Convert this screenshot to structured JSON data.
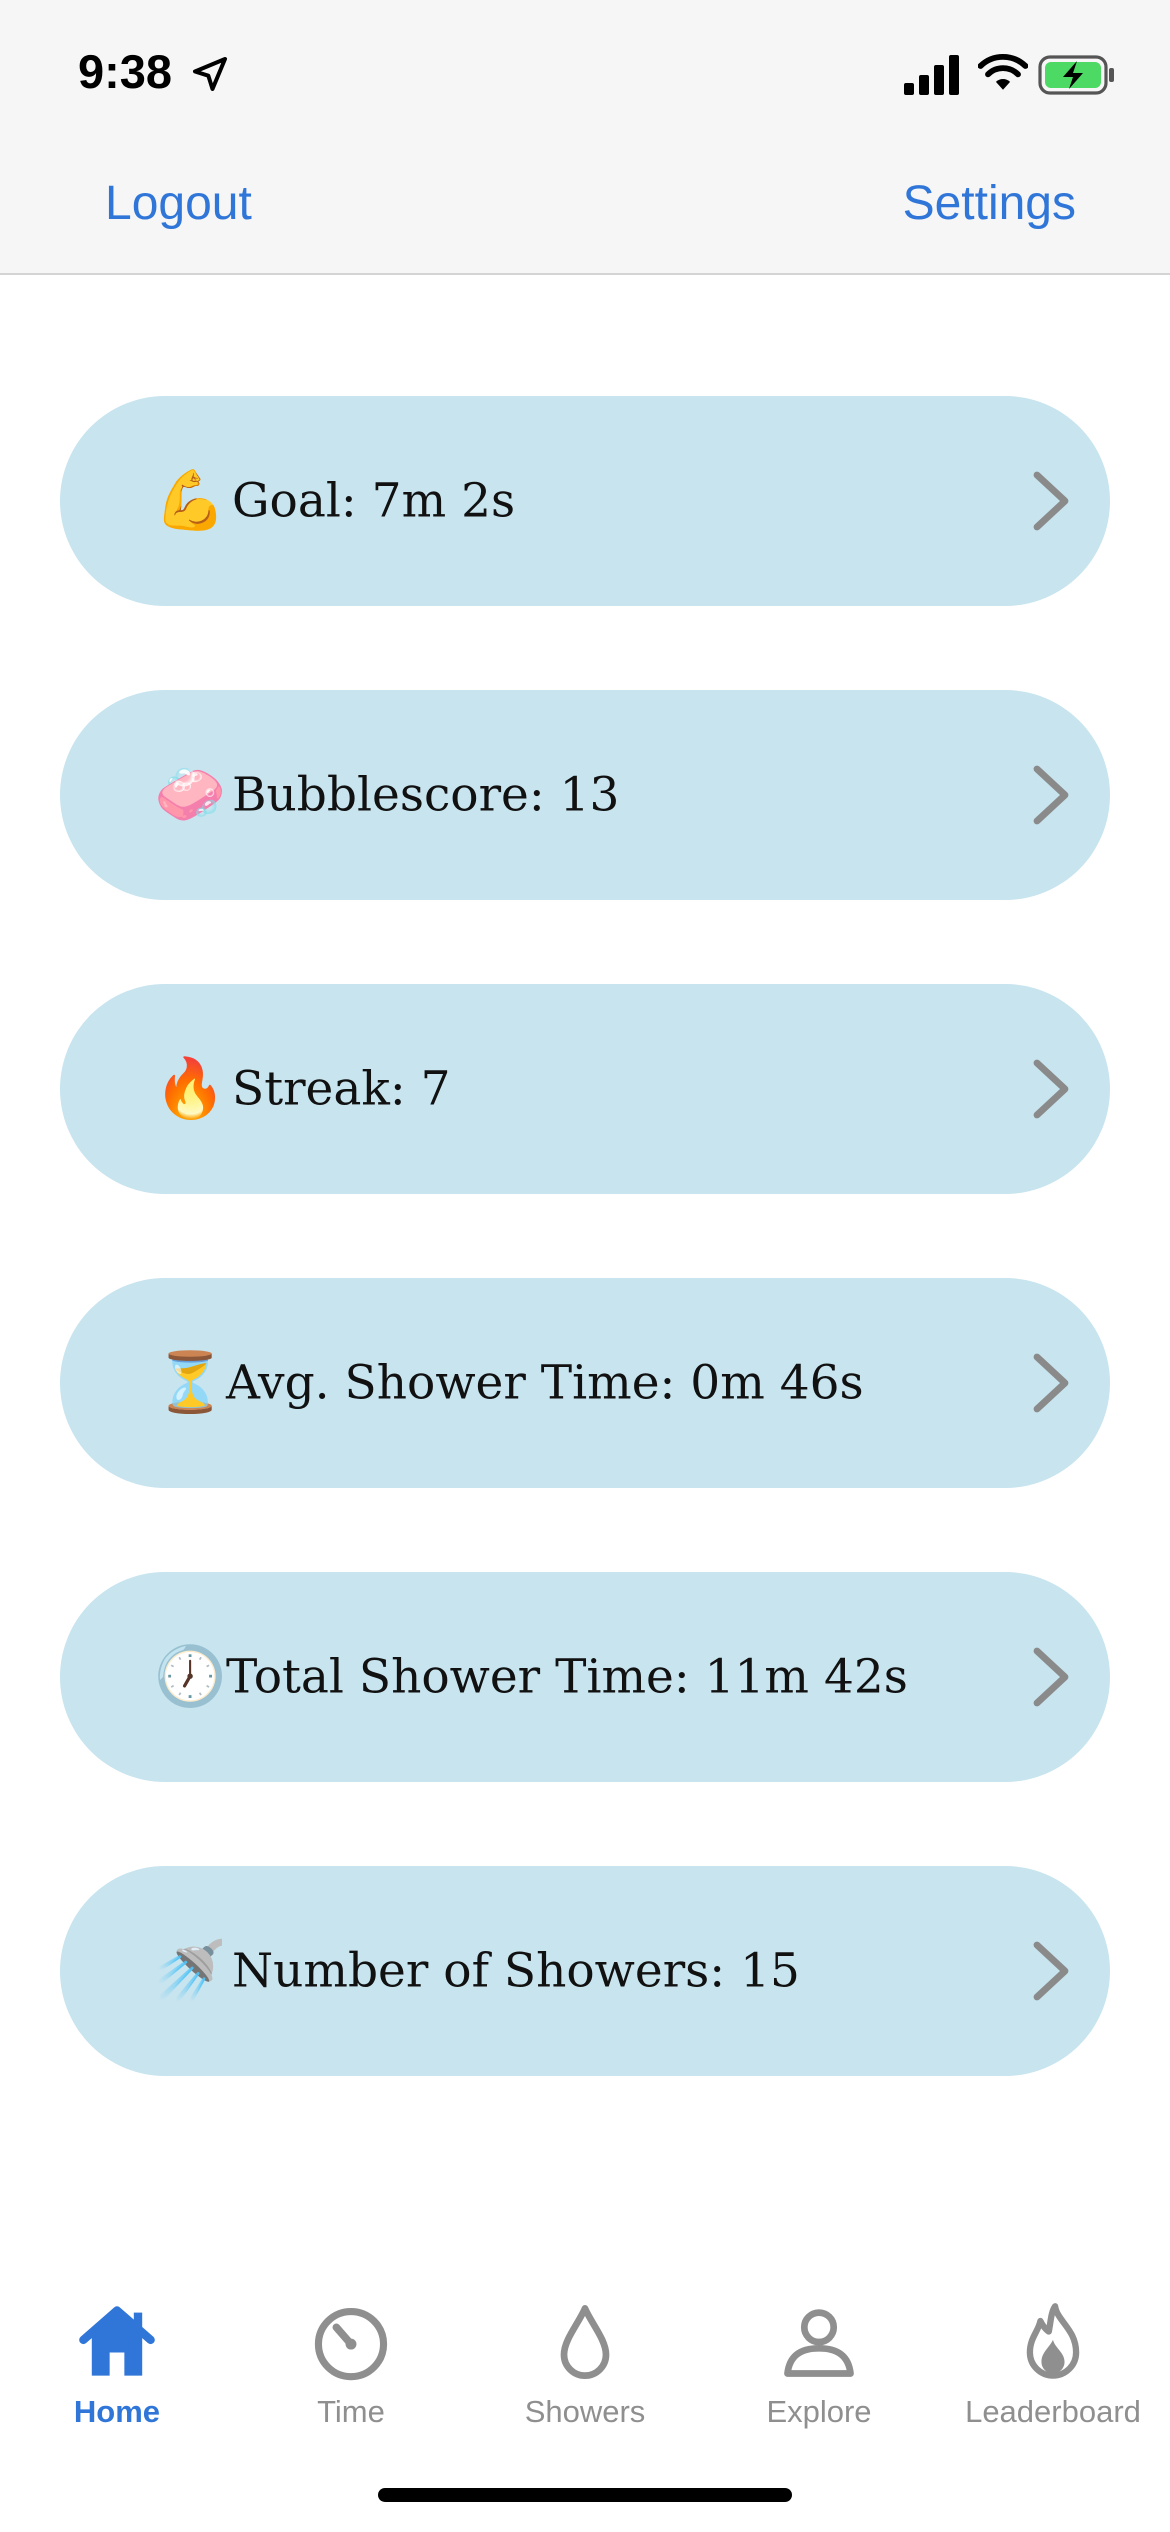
{
  "status_bar": {
    "time": "9:38",
    "icons": [
      "location-arrow-icon",
      "cellular-signal-icon",
      "wifi-icon",
      "battery-charging-icon"
    ]
  },
  "nav": {
    "left_label": "Logout",
    "right_label": "Settings",
    "accent_color": "#2f76d8"
  },
  "cards": [
    {
      "emoji": "💪",
      "icon": "flexed-biceps-icon",
      "label": "Goal:  7m 2s"
    },
    {
      "emoji": "🧼",
      "icon": "soap-icon",
      "label": "Bubblescore:  13"
    },
    {
      "emoji": "🔥",
      "icon": "fire-icon",
      "label": "Streak:  7"
    },
    {
      "emoji": "⏳",
      "icon": "hourglass-icon",
      "label": "Avg. Shower Time:  0m 46s"
    },
    {
      "emoji": "🕖",
      "icon": "clock-icon",
      "label": "Total Shower Time:  11m 42s"
    },
    {
      "emoji": "🚿",
      "icon": "shower-icon",
      "label": "Number of Showers:  15"
    }
  ],
  "card_color": "#c7e4ef",
  "tabs": [
    {
      "label": "Home",
      "icon": "home-icon",
      "active": true
    },
    {
      "label": "Time",
      "icon": "timer-icon",
      "active": false
    },
    {
      "label": "Showers",
      "icon": "water-drop-icon",
      "active": false
    },
    {
      "label": "Explore",
      "icon": "person-icon",
      "active": false
    },
    {
      "label": "Leaderboard",
      "icon": "flame-icon",
      "active": false
    }
  ]
}
